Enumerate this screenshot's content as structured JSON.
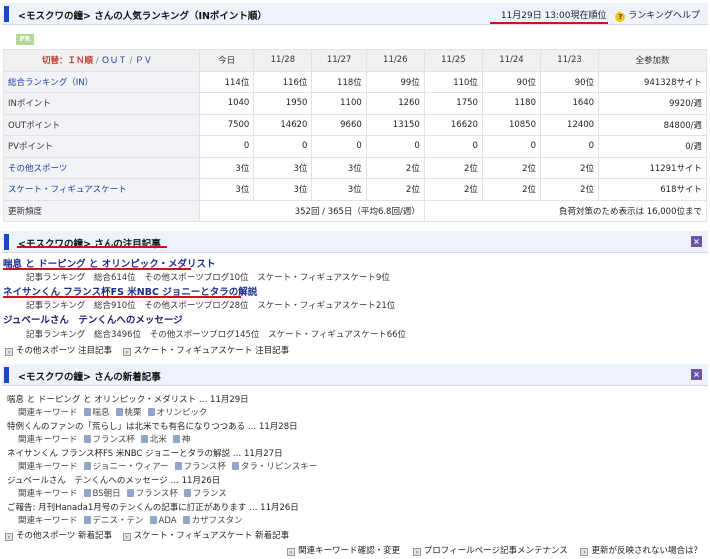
{
  "ranking": {
    "title": "<モスクワの鐘> さんの人気ランキング（INポイント順）",
    "timestamp": "11月29日 13:00現在順位",
    "help": "ランキングヘルプ",
    "pr": "PR",
    "tabs": {
      "active": "切替：ＩＮ順",
      "out": "ＯＵＴ",
      "pv": "ＰＶ"
    },
    "columns": [
      "今日",
      "11/28",
      "11/27",
      "11/26",
      "11/25",
      "11/24",
      "11/23",
      "全参加数"
    ],
    "rows": [
      {
        "label": "総合ランキング（IN）",
        "link": true,
        "values": [
          "114位",
          "116位",
          "118位",
          "99位",
          "110位",
          "90位",
          "90位"
        ],
        "total": "941328サイト"
      },
      {
        "label": "INポイント",
        "link": false,
        "values": [
          "1040",
          "1950",
          "1100",
          "1260",
          "1750",
          "1180",
          "1640"
        ],
        "total": "9920/週"
      },
      {
        "label": "OUTポイント",
        "link": false,
        "values": [
          "7500",
          "14620",
          "9660",
          "13150",
          "16620",
          "10850",
          "12400"
        ],
        "total": "84800/週"
      },
      {
        "label": "PVポイント",
        "link": false,
        "values": [
          "0",
          "0",
          "0",
          "0",
          "0",
          "0",
          "0"
        ],
        "total": "0/週"
      },
      {
        "label": "その他スポーツ",
        "link": true,
        "values": [
          "3位",
          "3位",
          "3位",
          "2位",
          "2位",
          "2位",
          "2位"
        ],
        "total": "11291サイト"
      },
      {
        "label": "スケート・フィギュアスケート",
        "link": true,
        "values": [
          "3位",
          "3位",
          "3位",
          "2位",
          "2位",
          "2位",
          "2位"
        ],
        "total": "618サイト"
      }
    ],
    "frequency": {
      "label": "更新頻度",
      "value": "352回 / 365日（平均6.8回/週）",
      "note": "負荷対策のため表示は 16,000位まで"
    }
  },
  "notable": {
    "title": "<モスクワの鐘> さんの注目記事",
    "articles": [
      {
        "title": "喘息 と ドーピング と オリンピック・メダリスト",
        "meta": [
          "記事ランキング",
          "総合614位",
          "その他スポーツブログ10位",
          "スケート・フィギュアスケート9位"
        ]
      },
      {
        "title": "ネイサンくん フランス杯FS 米NBC ジョニーとタラの解説",
        "meta": [
          "記事ランキング",
          "総合910位",
          "その他スポーツブログ28位",
          "スケート・フィギュアスケート21位"
        ]
      },
      {
        "title": "ジュベールさん　テンくんへのメッセージ",
        "meta": [
          "記事ランキング",
          "総合3496位",
          "その他スポーツブログ145位",
          "スケート・フィギュアスケート66位"
        ]
      }
    ],
    "links": [
      "その他スポーツ 注目記事",
      "スケート・フィギュアスケート 注目記事"
    ]
  },
  "recent": {
    "title": "<モスクワの鐘> さんの新着記事",
    "kw_label": "関連キーワード",
    "items": [
      {
        "title": "喘息 と ドーピング と オリンピック・メダリスト … 11月29日",
        "keywords": [
          "喘息",
          "桃栗",
          "オリンピック"
        ]
      },
      {
        "title": "特例くんのファンの「荒らし」は北米でも有名になりつつある … 11月28日",
        "keywords": [
          "フランス杯",
          "北米",
          "神"
        ]
      },
      {
        "title": "ネイサンくん フランス杯FS 米NBC ジョニーとタラの解説 … 11月27日",
        "keywords": [
          "ジョニー・ウィアー",
          "フランス杯",
          "タラ・リピンスキー"
        ]
      },
      {
        "title": "ジュベールさん　テンくんへのメッセージ … 11月26日",
        "keywords": [
          "BS朝日",
          "フランス杯",
          "フランス"
        ]
      },
      {
        "title": "ご報告: 月刊Hanada1月号のテンくんの記事に訂正があります … 11月26日",
        "keywords": [
          "デニス・テン",
          "ADA",
          "カザフスタン"
        ]
      }
    ],
    "links": [
      "その他スポーツ 新着記事",
      "スケート・フィギュアスケート 新着記事"
    ],
    "footer": [
      "関連キーワード確認・変更",
      "プロフィールページ記事メンテナンス",
      "更新が反映されない場合は？"
    ]
  }
}
